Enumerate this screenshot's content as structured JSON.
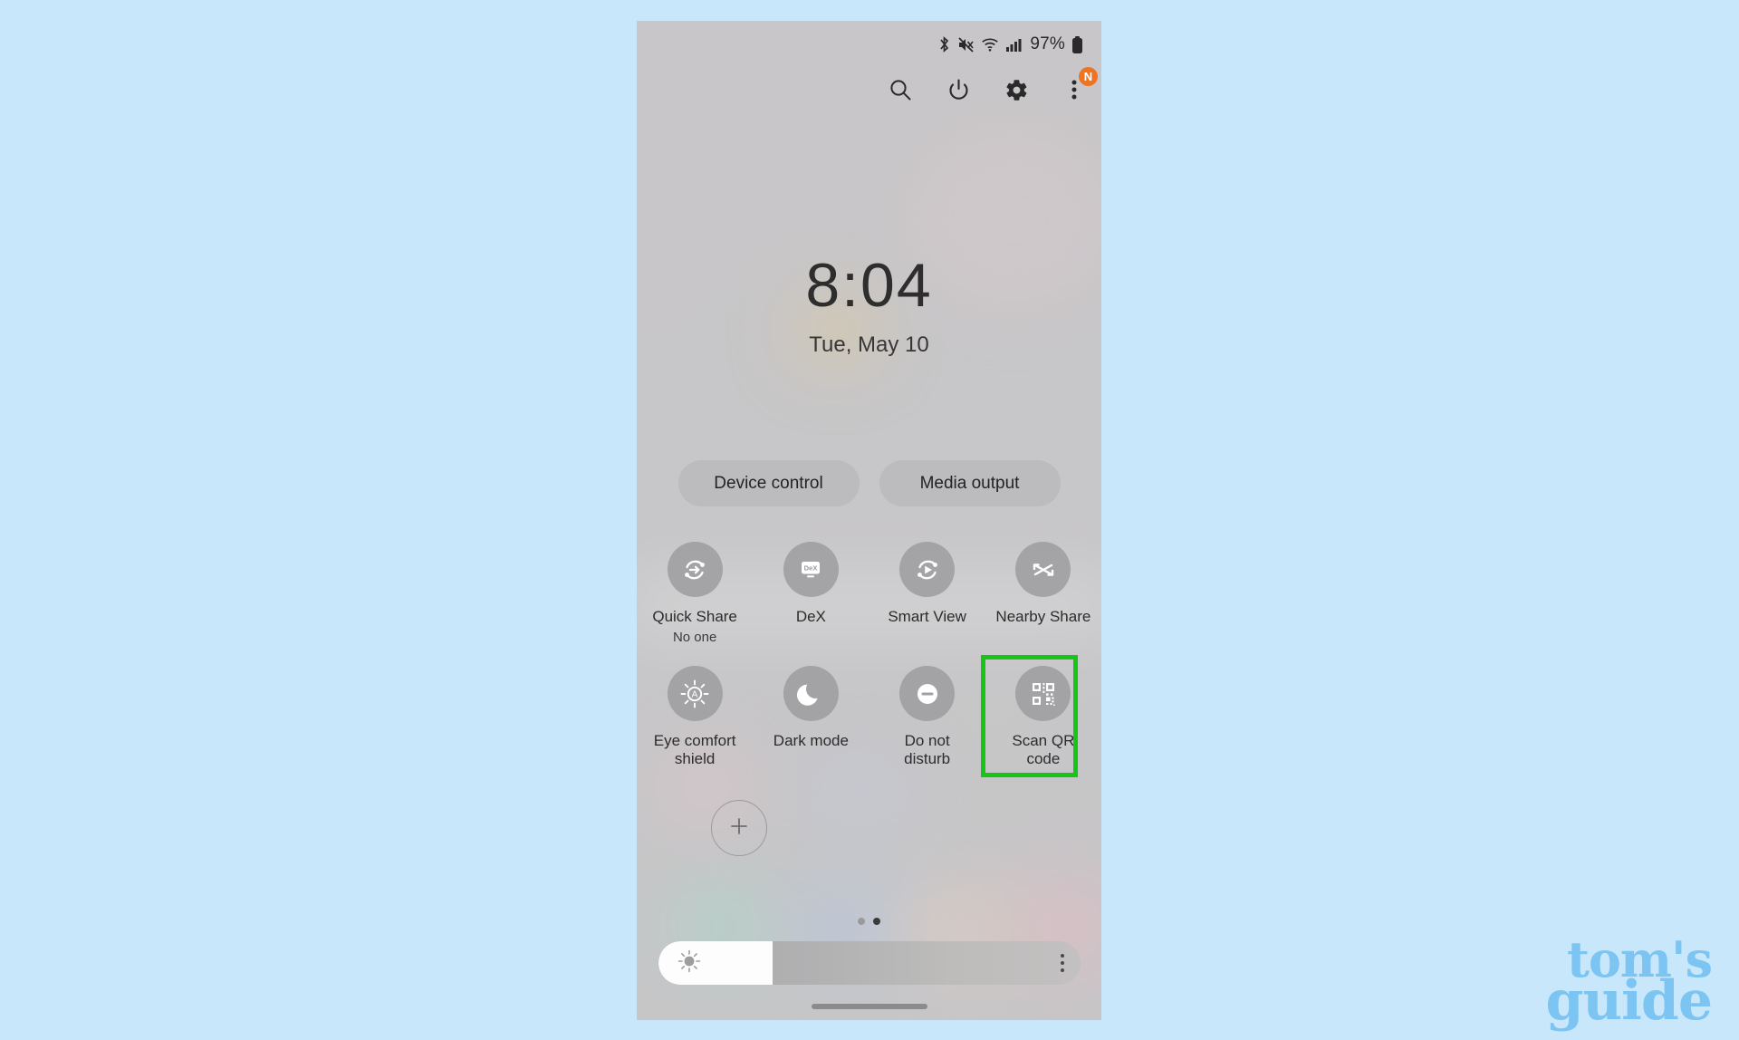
{
  "page": {
    "background_color": "#c9e7fb",
    "watermark_color": "#7cc4f2",
    "watermark_line1": "tom's",
    "watermark_line2": "guide"
  },
  "phone": {
    "statusbar": {
      "icons": [
        "bluetooth-icon",
        "mute-vibrate-icon",
        "wifi-icon",
        "signal-icon"
      ],
      "battery_percent": "97%",
      "battery_icon": "battery-icon"
    },
    "header_icons": [
      {
        "name": "search-icon",
        "label": "Search"
      },
      {
        "name": "power-icon",
        "label": "Power"
      },
      {
        "name": "settings-gear-icon",
        "label": "Settings"
      },
      {
        "name": "overflow-menu-icon",
        "label": "More options",
        "badge": "N",
        "badge_color": "#f07420"
      }
    ],
    "clock": {
      "time": "8:04",
      "date": "Tue, May 10"
    },
    "pills": [
      {
        "name": "device-control-button",
        "label": "Device control"
      },
      {
        "name": "media-output-button",
        "label": "Media output"
      }
    ],
    "quick_settings_row1": [
      {
        "name": "quick-share-toggle",
        "icon": "quick-share-icon",
        "label": "Quick Share",
        "sublabel": "No one"
      },
      {
        "name": "dex-toggle",
        "icon": "dex-icon",
        "label": "DeX",
        "sublabel": ""
      },
      {
        "name": "smart-view-toggle",
        "icon": "smart-view-icon",
        "label": "Smart View",
        "sublabel": ""
      },
      {
        "name": "nearby-share-toggle",
        "icon": "nearby-share-icon",
        "label": "Nearby Share",
        "sublabel": ""
      }
    ],
    "quick_settings_row2": [
      {
        "name": "eye-comfort-shield-toggle",
        "icon": "eye-comfort-shield-icon",
        "label": "Eye comfort shield",
        "sublabel": ""
      },
      {
        "name": "dark-mode-toggle",
        "icon": "moon-icon",
        "label": "Dark mode",
        "sublabel": ""
      },
      {
        "name": "do-not-disturb-toggle",
        "icon": "do-not-disturb-icon",
        "label": "Do not disturb",
        "sublabel": ""
      },
      {
        "name": "scan-qr-code-toggle",
        "icon": "qr-code-icon",
        "label": "Scan QR code",
        "sublabel": ""
      }
    ],
    "add_button": {
      "name": "add-tile-button",
      "icon": "plus-icon"
    },
    "page_indicator": {
      "total": 2,
      "active_index": 1
    },
    "brightness": {
      "name": "brightness-slider",
      "icon": "brightness-sun-icon",
      "fill_percent": 27,
      "menu_icon": "overflow-menu-icon"
    },
    "home_indicator": "home-gesture-bar"
  },
  "annotation": {
    "highlight_target": "Scan QR code",
    "highlight_color": "#17c517"
  }
}
